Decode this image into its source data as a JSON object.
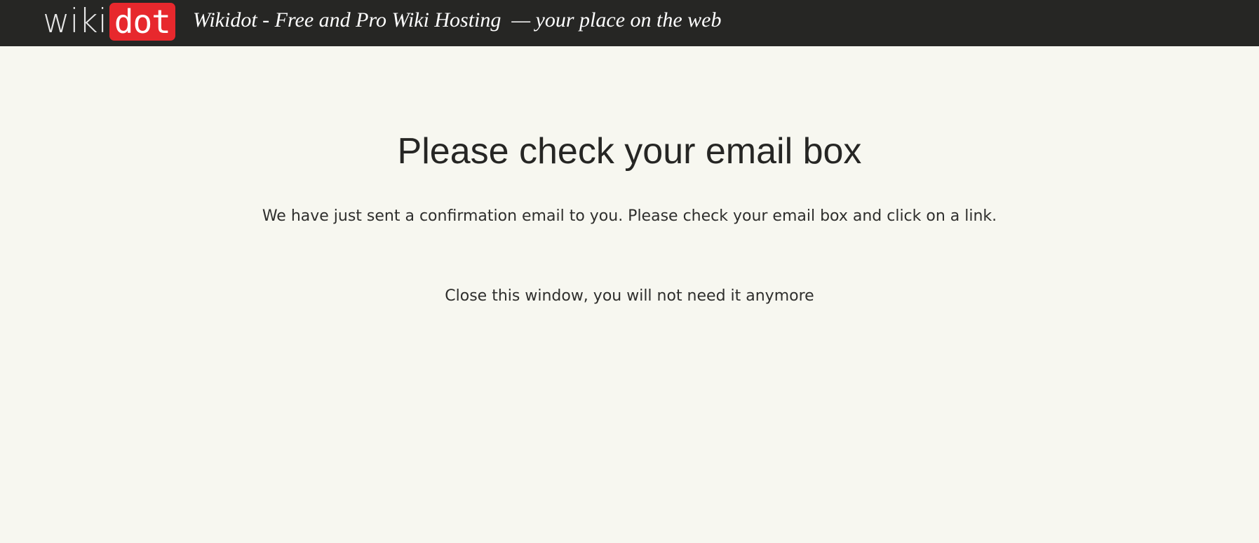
{
  "header": {
    "logo": {
      "wiki_text": "wiki",
      "dot_text": "dot"
    },
    "tagline": "Wikidot - Free and Pro Wiki Hosting  — your place on the web"
  },
  "main": {
    "title": "Please check your email box",
    "message": "We have just sent a confirmation email to you. Please check your email box and click on a link.",
    "close_text": "Close this window, you will not need it anymore"
  },
  "colors": {
    "header_bg": "#262624",
    "logo_accent": "#e7282d",
    "page_bg": "#f7f7f0",
    "text": "#262624"
  }
}
